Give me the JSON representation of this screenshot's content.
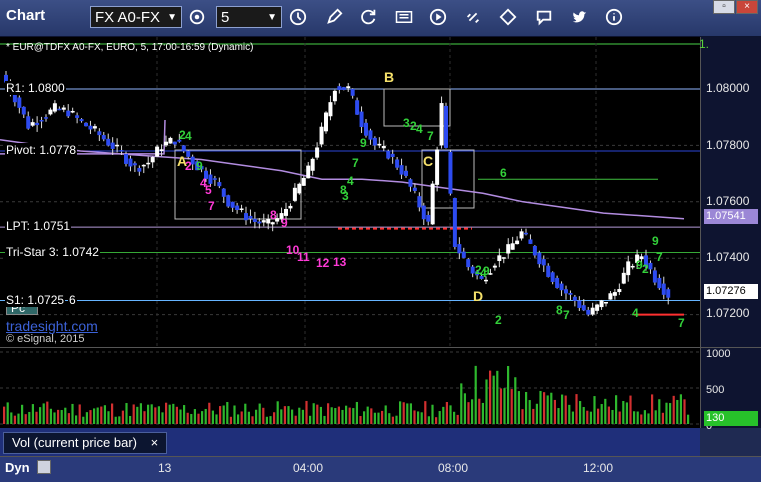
{
  "toolbar": {
    "title": "Chart",
    "symbol": "FX A0-FX",
    "interval": "5",
    "colors": {
      "bg": "#2f4278",
      "text": "#ffffff"
    }
  },
  "window": {
    "restore_label": "▫",
    "close_label": "×"
  },
  "chart": {
    "header": "* EUR@TDFX A0-FX, EURO, 5, 17:00-16:59 (Dynamic)",
    "watermark": "tradesight.com",
    "copyright": "© eSignal, 2015",
    "pc_label": "Pc",
    "levels": {
      "r1": "R1: 1.0800",
      "pivot": "Pivot: 1.0778",
      "lpt": "LPT: 1.0751",
      "tristar": "Tri-Star 3: 1.0742",
      "s1": "S1: 1.0725"
    },
    "stray_num_s1": "6",
    "price_axis": {
      "ticks": [
        "1.08000",
        "1.07800",
        "1.07600",
        "1.07400",
        "1.07200"
      ],
      "badge_lavender": "1.07541",
      "badge_current": "1.07276",
      "top_partial": "1."
    },
    "pattern_labels": {
      "a": "A",
      "b": "B",
      "c": "C",
      "d": "D"
    },
    "count_green": [
      "2",
      "4",
      "9",
      "7",
      "9",
      "2",
      "4",
      "7",
      "3",
      "4",
      "8",
      "3",
      "6",
      "2",
      "4",
      "9",
      "2",
      "8",
      "7",
      "9",
      "7",
      "9",
      "2",
      "4",
      "7"
    ],
    "count_magenta": [
      "2",
      "4",
      "5",
      "7",
      "8",
      "9",
      "10",
      "11",
      "12",
      "13"
    ]
  },
  "volume": {
    "ticks": [
      "1000",
      "500",
      "0"
    ],
    "current": "130",
    "label": "Vol (current price bar)",
    "close_label": "×"
  },
  "time_axis": {
    "dyn_label": "Dyn",
    "ticks": [
      "13",
      "04:00",
      "08:00",
      "12:00"
    ]
  },
  "chart_data": {
    "type": "candlestick",
    "instrument": "EUR@TDFX A0-FX",
    "interval": "5",
    "y_ticks": [
      1.08,
      1.078,
      1.076,
      1.074,
      1.072
    ],
    "x_ticks": [
      "13",
      "04:00",
      "08:00",
      "12:00"
    ],
    "levels": {
      "R1": 1.08,
      "Pivot": 1.0778,
      "LPT": 1.0751,
      "Tri-Star 3": 1.0742,
      "S1": 1.0725
    },
    "last": 1.07276,
    "lavender_ma_last": 1.07541,
    "volume_ticks": [
      0,
      500,
      1000
    ],
    "volume_current": 130,
    "price_path": [
      1.0805,
      1.0797,
      1.0787,
      1.079,
      1.0793,
      1.0792,
      1.0788,
      1.0785,
      1.0781,
      1.0777,
      1.0772,
      1.0774,
      1.078,
      1.0782,
      1.0776,
      1.0771,
      1.0767,
      1.076,
      1.0756,
      1.0753,
      1.0752,
      1.0755,
      1.0763,
      1.0771,
      1.0785,
      1.0801,
      1.08,
      1.0788,
      1.078,
      1.0777,
      1.0771,
      1.0762,
      1.0752,
      1.0794,
      1.0745,
      1.0737,
      1.0732,
      1.0739,
      1.0743,
      1.0749,
      1.0742,
      1.0735,
      1.0729,
      1.0725,
      1.072,
      1.0724,
      1.0728,
      1.0737,
      1.0741,
      1.0733,
      1.0727
    ],
    "lavender_ma": [
      1.0782,
      1.078,
      1.0778,
      1.0777,
      1.0776,
      1.0775,
      1.0773,
      1.0771,
      1.0768,
      1.0768,
      1.0767,
      1.0765,
      1.0763,
      1.076,
      1.0758,
      1.0756,
      1.0755,
      1.0754
    ]
  }
}
